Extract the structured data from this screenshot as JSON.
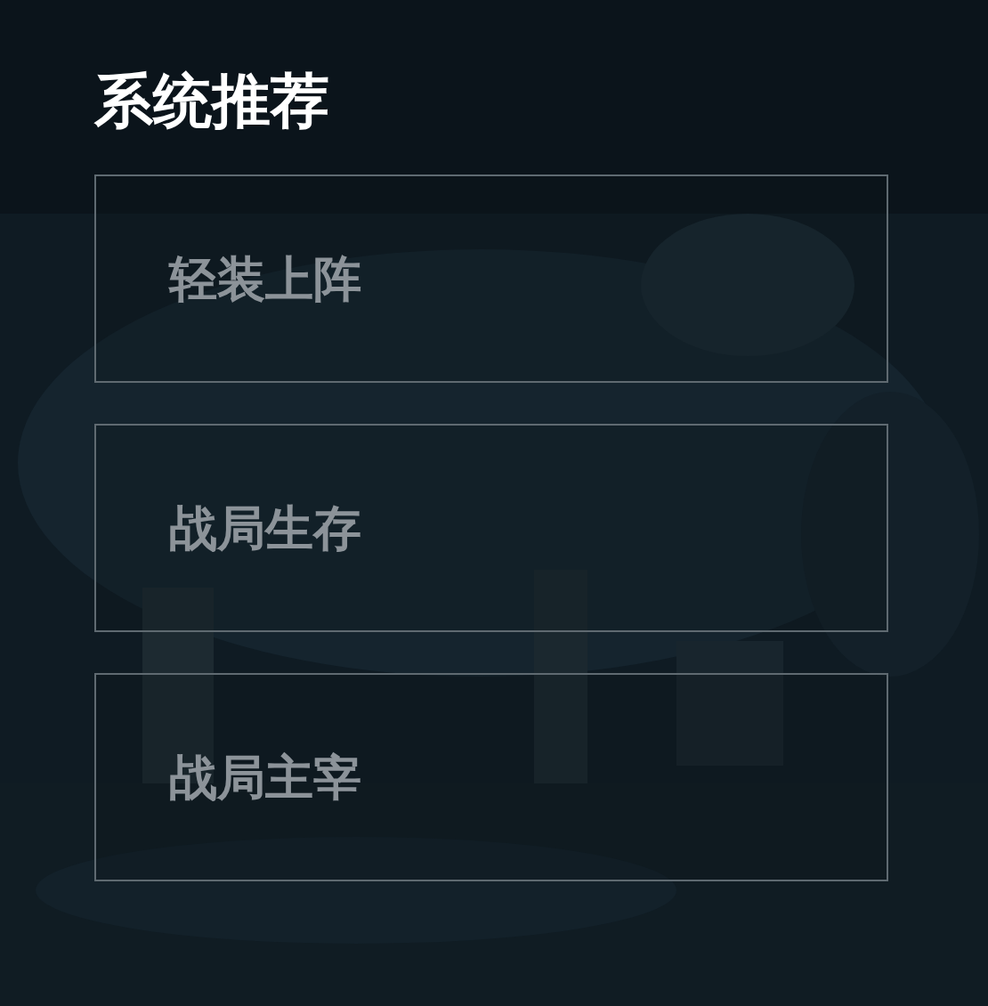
{
  "title": "系统推荐",
  "options": [
    {
      "label": "轻装上阵"
    },
    {
      "label": "战局生存"
    },
    {
      "label": "战局主宰"
    }
  ]
}
